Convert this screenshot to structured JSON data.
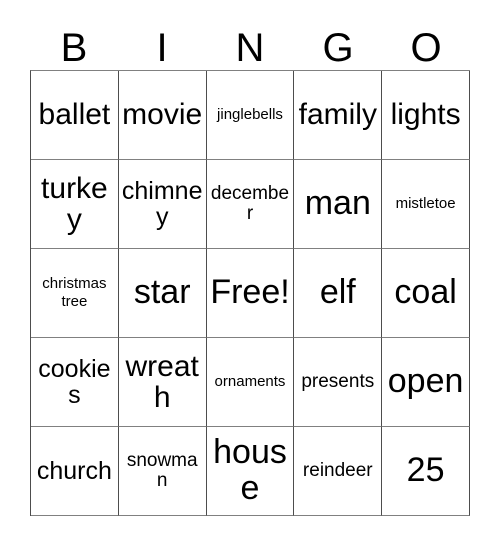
{
  "card": {
    "title": "BINGO",
    "headers": [
      "B",
      "I",
      "N",
      "G",
      "O"
    ],
    "free_space_label": "Free!",
    "free_space_position": {
      "row": 3,
      "column": 3
    },
    "grid_size": "5x5",
    "colors": {
      "background": "#ffffff",
      "text": "#000000",
      "grid_line": "#4d4d4d",
      "grid_line_light": "#808080"
    },
    "rows": [
      {
        "cells": [
          {
            "text": "ballet",
            "size": "lg"
          },
          {
            "text": "movie",
            "size": "lg"
          },
          {
            "text": "jinglebells",
            "size": "xs"
          },
          {
            "text": "family",
            "size": "lg"
          },
          {
            "text": "lights",
            "size": "lg"
          }
        ]
      },
      {
        "cells": [
          {
            "text": "turkey",
            "size": "lg"
          },
          {
            "text": "chimney",
            "size": "md"
          },
          {
            "text": "december",
            "size": "sm"
          },
          {
            "text": "man",
            "size": "xl"
          },
          {
            "text": "mistletoe",
            "size": "xs"
          }
        ]
      },
      {
        "cells": [
          {
            "text": "christmas tree",
            "size": "xs",
            "lines": 2
          },
          {
            "text": "star",
            "size": "xl"
          },
          {
            "text": "Free!",
            "size": "xl"
          },
          {
            "text": "elf",
            "size": "xl"
          },
          {
            "text": "coal",
            "size": "xl"
          }
        ]
      },
      {
        "cells": [
          {
            "text": "cookies",
            "size": "md"
          },
          {
            "text": "wreath",
            "size": "lg"
          },
          {
            "text": "ornaments",
            "size": "xs"
          },
          {
            "text": "presents",
            "size": "sm"
          },
          {
            "text": "open",
            "size": "xl"
          }
        ]
      },
      {
        "cells": [
          {
            "text": "church",
            "size": "md"
          },
          {
            "text": "snowman",
            "size": "sm"
          },
          {
            "text": "house",
            "size": "xl"
          },
          {
            "text": "reindeer",
            "size": "sm"
          },
          {
            "text": "25",
            "size": "xl"
          }
        ]
      }
    ]
  }
}
